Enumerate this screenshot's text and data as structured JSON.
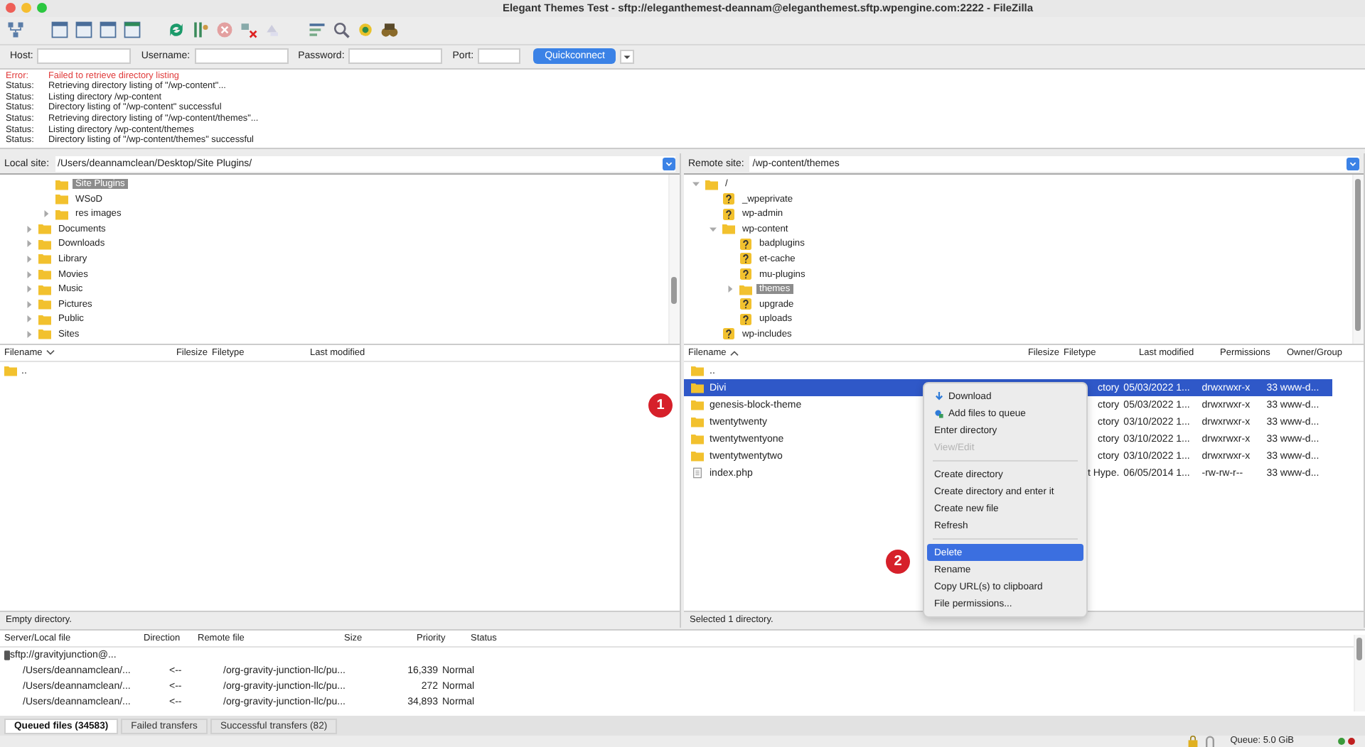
{
  "window": {
    "title": "Elegant Themes Test - sftp://eleganthemest-deannam@eleganthemest.sftp.wpengine.com:2222 - FileZilla"
  },
  "quickconnect": {
    "fields": [
      {
        "label": "Host:"
      },
      {
        "label": "Username:"
      },
      {
        "label": "Password:"
      },
      {
        "label": "Port:"
      }
    ],
    "button": "Quickconnect"
  },
  "log": [
    {
      "kind": "error",
      "label": "Error:",
      "message": "Failed to retrieve directory listing"
    },
    {
      "kind": "status",
      "label": "Status:",
      "message": "Retrieving directory listing of \"/wp-content\"..."
    },
    {
      "kind": "status",
      "label": "Status:",
      "message": "Listing directory /wp-content"
    },
    {
      "kind": "status",
      "label": "Status:",
      "message": "Directory listing of \"/wp-content\" successful"
    },
    {
      "kind": "status",
      "label": "Status:",
      "message": "Retrieving directory listing of \"/wp-content/themes\"..."
    },
    {
      "kind": "status",
      "label": "Status:",
      "message": "Listing directory /wp-content/themes"
    },
    {
      "kind": "status",
      "label": "Status:",
      "message": "Directory listing of \"/wp-content/themes\" successful"
    }
  ],
  "local": {
    "site_label": "Local site:",
    "path": "/Users/deannamclean/Desktop/Site Plugins/",
    "tree_partial": [
      {
        "label": "Site Plugins",
        "kind": "folder",
        "selected": true
      },
      {
        "label": "WSoD",
        "kind": "folder",
        "selected": false
      },
      {
        "label": "res images",
        "kind": "folder",
        "selected": false,
        "expanded": false
      }
    ],
    "tree": [
      {
        "label": "Documents",
        "kind": "folder",
        "selected": false,
        "expanded": false
      },
      {
        "label": "Downloads",
        "kind": "folder",
        "selected": false,
        "expanded": false
      },
      {
        "label": "Library",
        "kind": "folder",
        "selected": false,
        "expanded": false
      },
      {
        "label": "Movies",
        "kind": "folder",
        "selected": false,
        "expanded": false
      },
      {
        "label": "Music",
        "kind": "folder",
        "selected": false,
        "expanded": false
      },
      {
        "label": "Pictures",
        "kind": "folder",
        "selected": false,
        "expanded": false
      },
      {
        "label": "Public",
        "kind": "folder",
        "selected": false,
        "expanded": false
      },
      {
        "label": "Sites",
        "kind": "folder",
        "selected": false,
        "expanded": false
      }
    ],
    "columns": [
      "Filename",
      "Filesize",
      "Filetype",
      "Last modified"
    ],
    "rows": [
      {
        "name": ".."
      }
    ],
    "status": "Empty directory."
  },
  "remote": {
    "site_label": "Remote site:",
    "path": "/wp-content/themes",
    "tree": [
      {
        "label": "/",
        "kind": "folder",
        "selected": false,
        "expanded": true,
        "children": [
          {
            "label": "_wpeprivate",
            "kind": "unknown",
            "selected": false
          },
          {
            "label": "wp-admin",
            "kind": "unknown",
            "selected": false
          },
          {
            "label": "wp-content",
            "kind": "folder",
            "selected": false,
            "expanded": true,
            "children": [
              {
                "label": "badplugins",
                "kind": "unknown",
                "selected": false
              },
              {
                "label": "et-cache",
                "kind": "unknown",
                "selected": false
              },
              {
                "label": "mu-plugins",
                "kind": "unknown",
                "selected": false
              },
              {
                "label": "themes",
                "kind": "folder",
                "selected": true,
                "expanded": false
              },
              {
                "label": "upgrade",
                "kind": "unknown",
                "selected": false
              },
              {
                "label": "uploads",
                "kind": "unknown",
                "selected": false
              }
            ]
          },
          {
            "label": "wp-includes",
            "kind": "unknown",
            "selected": false
          }
        ]
      }
    ],
    "columns": [
      "Filename",
      "Filesize",
      "Filetype",
      "Last modified",
      "Permissions",
      "Owner/Group"
    ],
    "rows": [
      {
        "name": "..",
        "kind": "folder",
        "selected": false
      },
      {
        "name": "Divi",
        "kind": "folder",
        "selected": true,
        "filetype": "ctory",
        "modified": "05/03/2022 1...",
        "permissions": "drwxrwxr-x",
        "owner": "33 www-d..."
      },
      {
        "name": "genesis-block-theme",
        "kind": "folder",
        "selected": false,
        "filetype": "ctory",
        "modified": "05/03/2022 1...",
        "permissions": "drwxrwxr-x",
        "owner": "33 www-d..."
      },
      {
        "name": "twentytwenty",
        "kind": "folder",
        "selected": false,
        "filetype": "ctory",
        "modified": "03/10/2022 1...",
        "permissions": "drwxrwxr-x",
        "owner": "33 www-d..."
      },
      {
        "name": "twentytwentyone",
        "kind": "folder",
        "selected": false,
        "filetype": "ctory",
        "modified": "03/10/2022 1...",
        "permissions": "drwxrwxr-x",
        "owner": "33 www-d..."
      },
      {
        "name": "twentytwentytwo",
        "kind": "folder",
        "selected": false,
        "filetype": "ctory",
        "modified": "03/10/2022 1...",
        "permissions": "drwxrwxr-x",
        "owner": "33 www-d..."
      },
      {
        "name": "index.php",
        "kind": "file",
        "selected": false,
        "filetype": "t Hype.",
        "modified": "06/05/2014 1...",
        "permissions": "-rw-rw-r--",
        "owner": "33 www-d..."
      }
    ],
    "status": "Selected 1 directory."
  },
  "context_menu": {
    "groups": [
      [
        {
          "label": "Download",
          "disabled": false,
          "selected": false
        },
        {
          "label": "Add files to queue",
          "disabled": false,
          "selected": false
        },
        {
          "label": "Enter directory",
          "disabled": false,
          "selected": false
        },
        {
          "label": "View/Edit",
          "disabled": true,
          "selected": false
        }
      ],
      [
        {
          "label": "Create directory",
          "disabled": false,
          "selected": false
        },
        {
          "label": "Create directory and enter it",
          "disabled": false,
          "selected": false
        },
        {
          "label": "Create new file",
          "disabled": false,
          "selected": false
        },
        {
          "label": "Refresh",
          "disabled": false,
          "selected": false
        }
      ],
      [
        {
          "label": "Delete",
          "disabled": false,
          "selected": true
        },
        {
          "label": "Rename",
          "disabled": false,
          "selected": false
        },
        {
          "label": "Copy URL(s) to clipboard",
          "disabled": false,
          "selected": false
        },
        {
          "label": "File permissions...",
          "disabled": false,
          "selected": false
        }
      ]
    ]
  },
  "step_markers": [
    "1",
    "2"
  ],
  "queue": {
    "columns": [
      "Server/Local file",
      "Direction",
      "Remote file",
      "Size",
      "Priority",
      "Status"
    ],
    "server": "sftp://gravityjunction@...",
    "rows": [
      {
        "local": "/Users/deannamclean/...",
        "direction": "<--",
        "remote": "/org-gravity-junction-llc/pu...",
        "size": "16,339",
        "priority": "Normal"
      },
      {
        "local": "/Users/deannamclean/...",
        "direction": "<--",
        "remote": "/org-gravity-junction-llc/pu...",
        "size": "272",
        "priority": "Normal"
      },
      {
        "local": "/Users/deannamclean/...",
        "direction": "<--",
        "remote": "/org-gravity-junction-llc/pu...",
        "size": "34,893",
        "priority": "Normal"
      }
    ]
  },
  "tabs": [
    {
      "label": "Queued files (34583)",
      "selected": true
    },
    {
      "label": "Failed transfers",
      "selected": false
    },
    {
      "label": "Successful transfers (82)",
      "selected": false
    }
  ],
  "status_bar": {
    "queue": "Queue: 5.0 GiB"
  }
}
